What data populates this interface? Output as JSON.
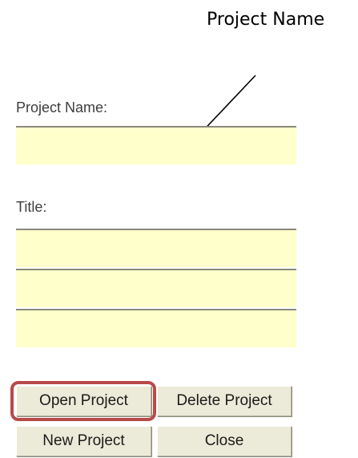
{
  "annotation": {
    "label": "Project Name"
  },
  "form": {
    "project_name": {
      "label": "Project Name:",
      "value": ""
    },
    "title": {
      "label": "Title:",
      "line1": "",
      "line2": "",
      "line3": ""
    }
  },
  "buttons": {
    "open_project": "Open Project",
    "delete_project": "Delete Project",
    "new_project": "New Project",
    "close": "Close"
  },
  "colors": {
    "input_background": "#ffffcc",
    "button_background": "#ecead8",
    "highlight_border": "#b84a4a",
    "label_text": "#3d3d3d"
  }
}
